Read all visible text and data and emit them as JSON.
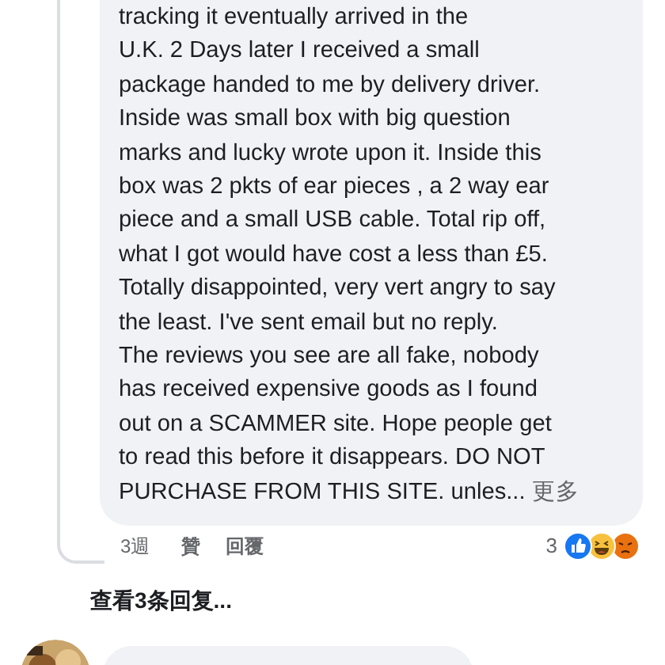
{
  "comment": {
    "lines": [
      "tracking it eventually arrived in the",
      "U.K. 2 Days later I received a small",
      "package handed to me by delivery driver.",
      "Inside was small box with big question",
      "marks and lucky wrote upon it. Inside this",
      "box was 2 pkts of ear pieces , a 2 way ear",
      "piece and a small USB cable. Total rip off,",
      "what I got would have cost a less than £5.",
      "Totally disappointed, very vert angry to say",
      "the least. I've sent email but no reply.",
      "The reviews you see are all fake, nobody",
      "has received expensive goods as I found",
      "out on a SCAMMER site. Hope people get",
      "to read this before it disappears. DO NOT",
      "PURCHASE FROM THIS SITE. unles..."
    ],
    "see_more": "更多",
    "time": "3週",
    "like": "贊",
    "reply": "回覆",
    "reaction_count": "3",
    "reactions": [
      {
        "kind": "like"
      },
      {
        "kind": "haha"
      },
      {
        "kind": "angry"
      }
    ]
  },
  "view_replies": "查看3条回复..."
}
